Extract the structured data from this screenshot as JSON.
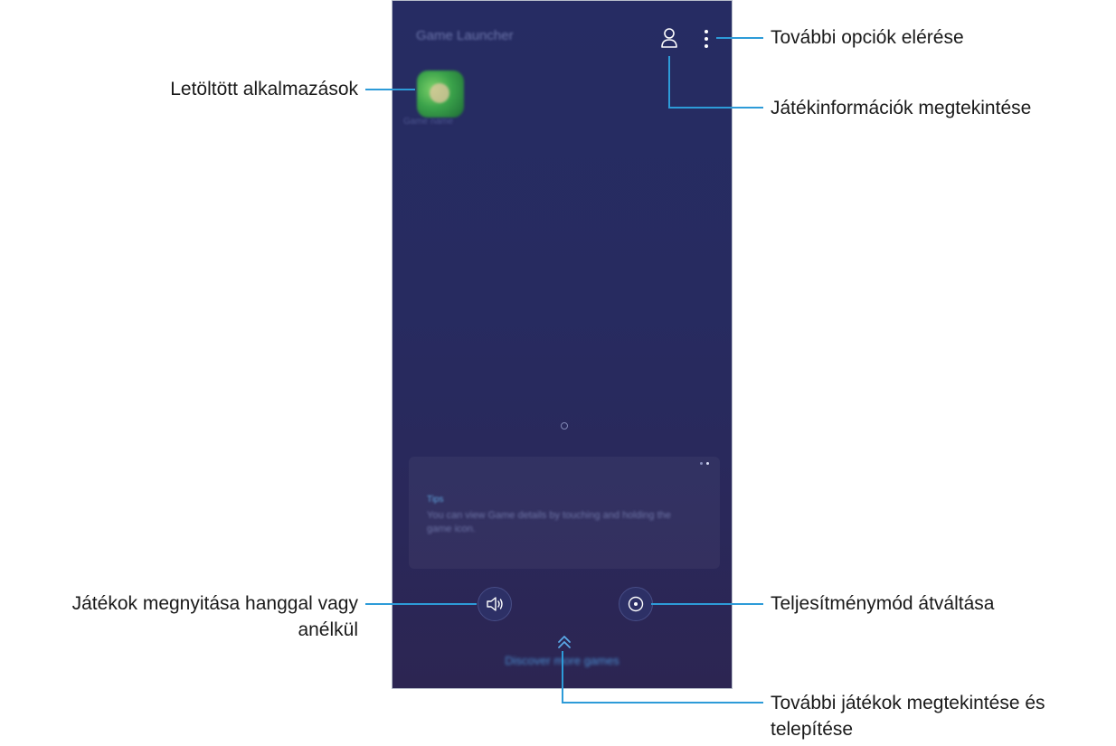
{
  "phone": {
    "app_title": "Game Launcher",
    "app_label": "Game name",
    "tip": {
      "title": "Tips",
      "body": "You can view Game details by touching and holding the game icon."
    },
    "discover_label": "Discover more games"
  },
  "callouts": {
    "more_options": "További opciók elérése",
    "game_info": "Játékinformációk megtekintése",
    "downloaded_apps": "Letöltött alkalmazások",
    "sound_line1": "Játékok megnyitása hanggal vagy",
    "sound_line2": "anélkül",
    "performance_mode": "Teljesítménymód átváltása",
    "discover_line1": "További játékok megtekintése és",
    "discover_line2": "telepítése"
  },
  "colors": {
    "callout_line": "#2d9bd8",
    "phone_background": "#272b60",
    "accent_blue": "#4a8fd0"
  },
  "icons": [
    "profile-icon",
    "more-options-icon",
    "sound-icon",
    "performance-icon",
    "chevron-up-icon"
  ]
}
